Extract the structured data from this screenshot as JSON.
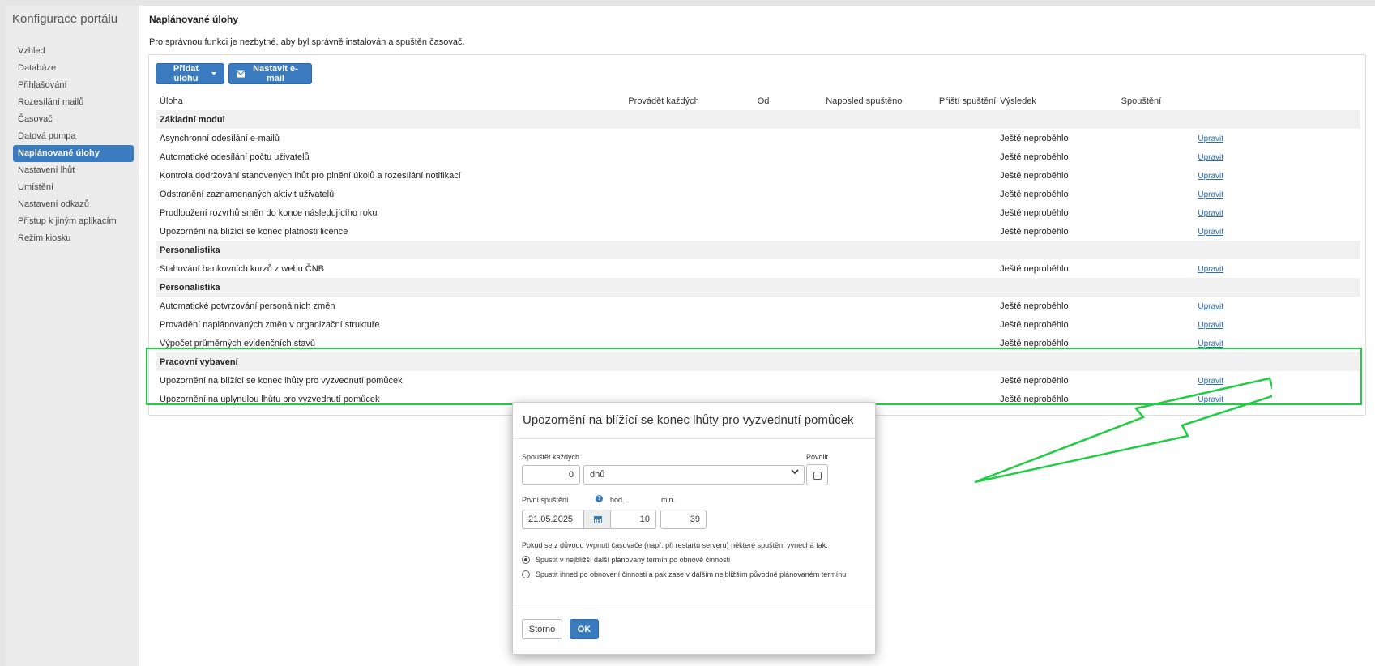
{
  "sidebar": {
    "title": "Konfigurace portálu",
    "items": [
      {
        "label": "Vzhled"
      },
      {
        "label": "Databáze"
      },
      {
        "label": "Přihlašování"
      },
      {
        "label": "Rozesílání mailů"
      },
      {
        "label": "Časovač"
      },
      {
        "label": "Datová pumpa"
      },
      {
        "label": "Naplánované úlohy"
      },
      {
        "label": "Nastavení lhůt"
      },
      {
        "label": "Umístění"
      },
      {
        "label": "Nastavení odkazů"
      },
      {
        "label": "Přístup k jiným aplikacím"
      },
      {
        "label": "Režim kiosku"
      }
    ],
    "active_index": 6
  },
  "main": {
    "title": "Naplánované úlohy",
    "note": "Pro správnou funkci je nezbytné, aby byl správně instalován a spuštěn časovač.",
    "toolbar": {
      "add_label": "Přidat úlohu",
      "email_label": "Nastavit e-mail"
    },
    "table": {
      "headers": [
        "Úloha",
        "Provádět každých",
        "Od",
        "Naposled spuštěno",
        "Příští spuštění",
        "Výsledek",
        "Spouštění"
      ],
      "groups": [
        {
          "name": "Základní modul",
          "rows": [
            {
              "task": "Asynchronní odesílání e-mailů",
              "result": "Ještě neproběhlo",
              "action": "Upravit"
            },
            {
              "task": "Automatické odesílání počtu uživatelů",
              "result": "Ještě neproběhlo",
              "action": "Upravit"
            },
            {
              "task": "Kontrola dodržování stanovených lhůt pro plnění úkolů a rozesílání notifikací",
              "result": "Ještě neproběhlo",
              "action": "Upravit"
            },
            {
              "task": "Odstranění zaznamenaných aktivit uživatelů",
              "result": "Ještě neproběhlo",
              "action": "Upravit"
            },
            {
              "task": "Prodloužení rozvrhů směn do konce následujícího roku",
              "result": "Ještě neproběhlo",
              "action": "Upravit"
            },
            {
              "task": "Upozornění na blížící se konec platnosti licence",
              "result": "Ještě neproběhlo",
              "action": "Upravit"
            }
          ]
        },
        {
          "name": "Personalistika",
          "rows": [
            {
              "task": "Stahování bankovních kurzů z webu ČNB",
              "result": "Ještě neproběhlo",
              "action": "Upravit"
            }
          ]
        },
        {
          "name": "Personalistika",
          "rows": [
            {
              "task": "Automatické potvrzování personálních změn",
              "result": "Ještě neproběhlo",
              "action": "Upravit"
            },
            {
              "task": "Provádění naplánovaných změn v organizační struktuře",
              "result": "Ještě neproběhlo",
              "action": "Upravit"
            },
            {
              "task": "Výpočet průměrných evidenčních stavů",
              "result": "Ještě neproběhlo",
              "action": "Upravit"
            }
          ]
        },
        {
          "name": "Pracovní vybavení",
          "rows": [
            {
              "task": "Upozornění na blížící se konec lhůty pro vyzvednutí pomůcek",
              "result": "Ještě neproběhlo",
              "action": "Upravit"
            },
            {
              "task": "Upozornění na uplynulou lhůtu pro vyzvednutí pomůcek",
              "result": "Ještě neproběhlo",
              "action": "Upravit"
            }
          ]
        }
      ]
    }
  },
  "modal": {
    "title": "Upozornění na blížící se konec lhůty pro vyzvednutí pomůcek",
    "run_every_label": "Spouštět každých",
    "run_every_value": "0",
    "unit_value": "dnů",
    "enable_label": "Povolit",
    "first_run_label": "První spuštění",
    "date_value": "21.05.2025",
    "hour_label": "hod.",
    "hour_value": "10",
    "min_label": "min.",
    "min_value": "39",
    "missed_note": "Pokud se z důvodu vypnutí časovače (např. při restartu serveru) některé spuštění vynechá tak:",
    "option1": "Spustit v nejbližší další plánovaný termín po obnově činnosti",
    "option2": "Spustit ihned po obnovení činnosti a pak zase v dalším nejbližším původně plánovaném termínu",
    "cancel_label": "Storno",
    "ok_label": "OK"
  },
  "colors": {
    "accent": "#3a7bbf",
    "highlight": "#22cc44",
    "link": "#2a6db3"
  }
}
